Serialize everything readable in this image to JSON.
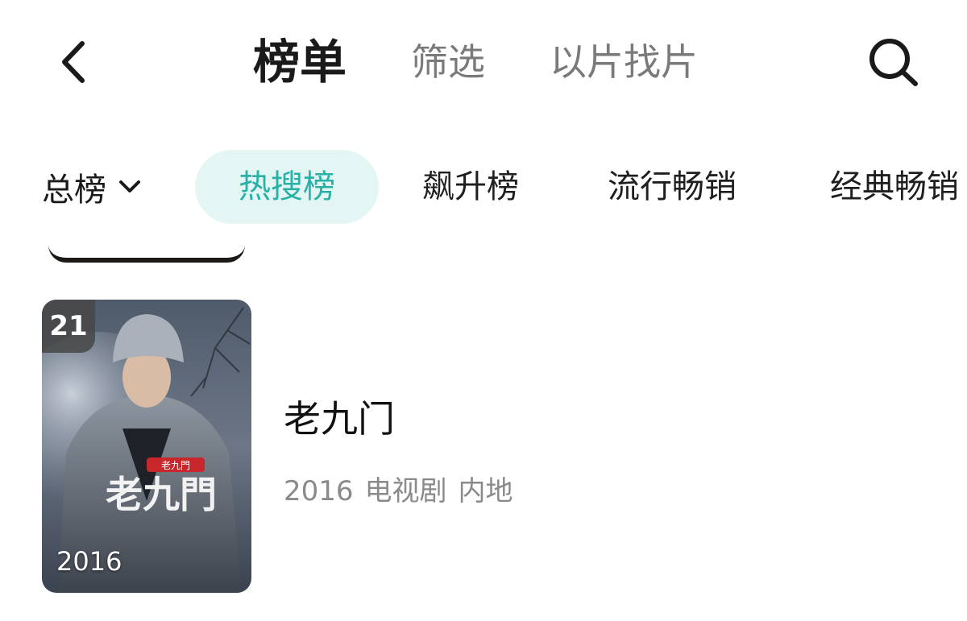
{
  "header": {
    "tabs": [
      {
        "label": "榜单",
        "active": true
      },
      {
        "label": "筛选",
        "active": false
      },
      {
        "label": "以片找片",
        "active": false
      }
    ],
    "back_icon": "chevron-left-icon",
    "search_icon": "search-icon"
  },
  "filters": {
    "dropdown": {
      "label": "总榜",
      "icon": "chevron-down-icon"
    },
    "chips": [
      {
        "label": "热搜榜",
        "active": true
      },
      {
        "label": "飙升榜",
        "active": false
      },
      {
        "label": "流行畅销",
        "active": false
      },
      {
        "label": "经典畅销",
        "active": false
      }
    ]
  },
  "item": {
    "rank": "21",
    "poster_year": "2016",
    "poster_logo_text": "老九門",
    "title": "老九门",
    "meta": {
      "year": "2016",
      "type": "电视剧",
      "region": "内地"
    }
  },
  "colors": {
    "accent": "#29b1a7",
    "chip_active_bg": "#e3f6f4",
    "muted_text": "#7a7a7a"
  }
}
